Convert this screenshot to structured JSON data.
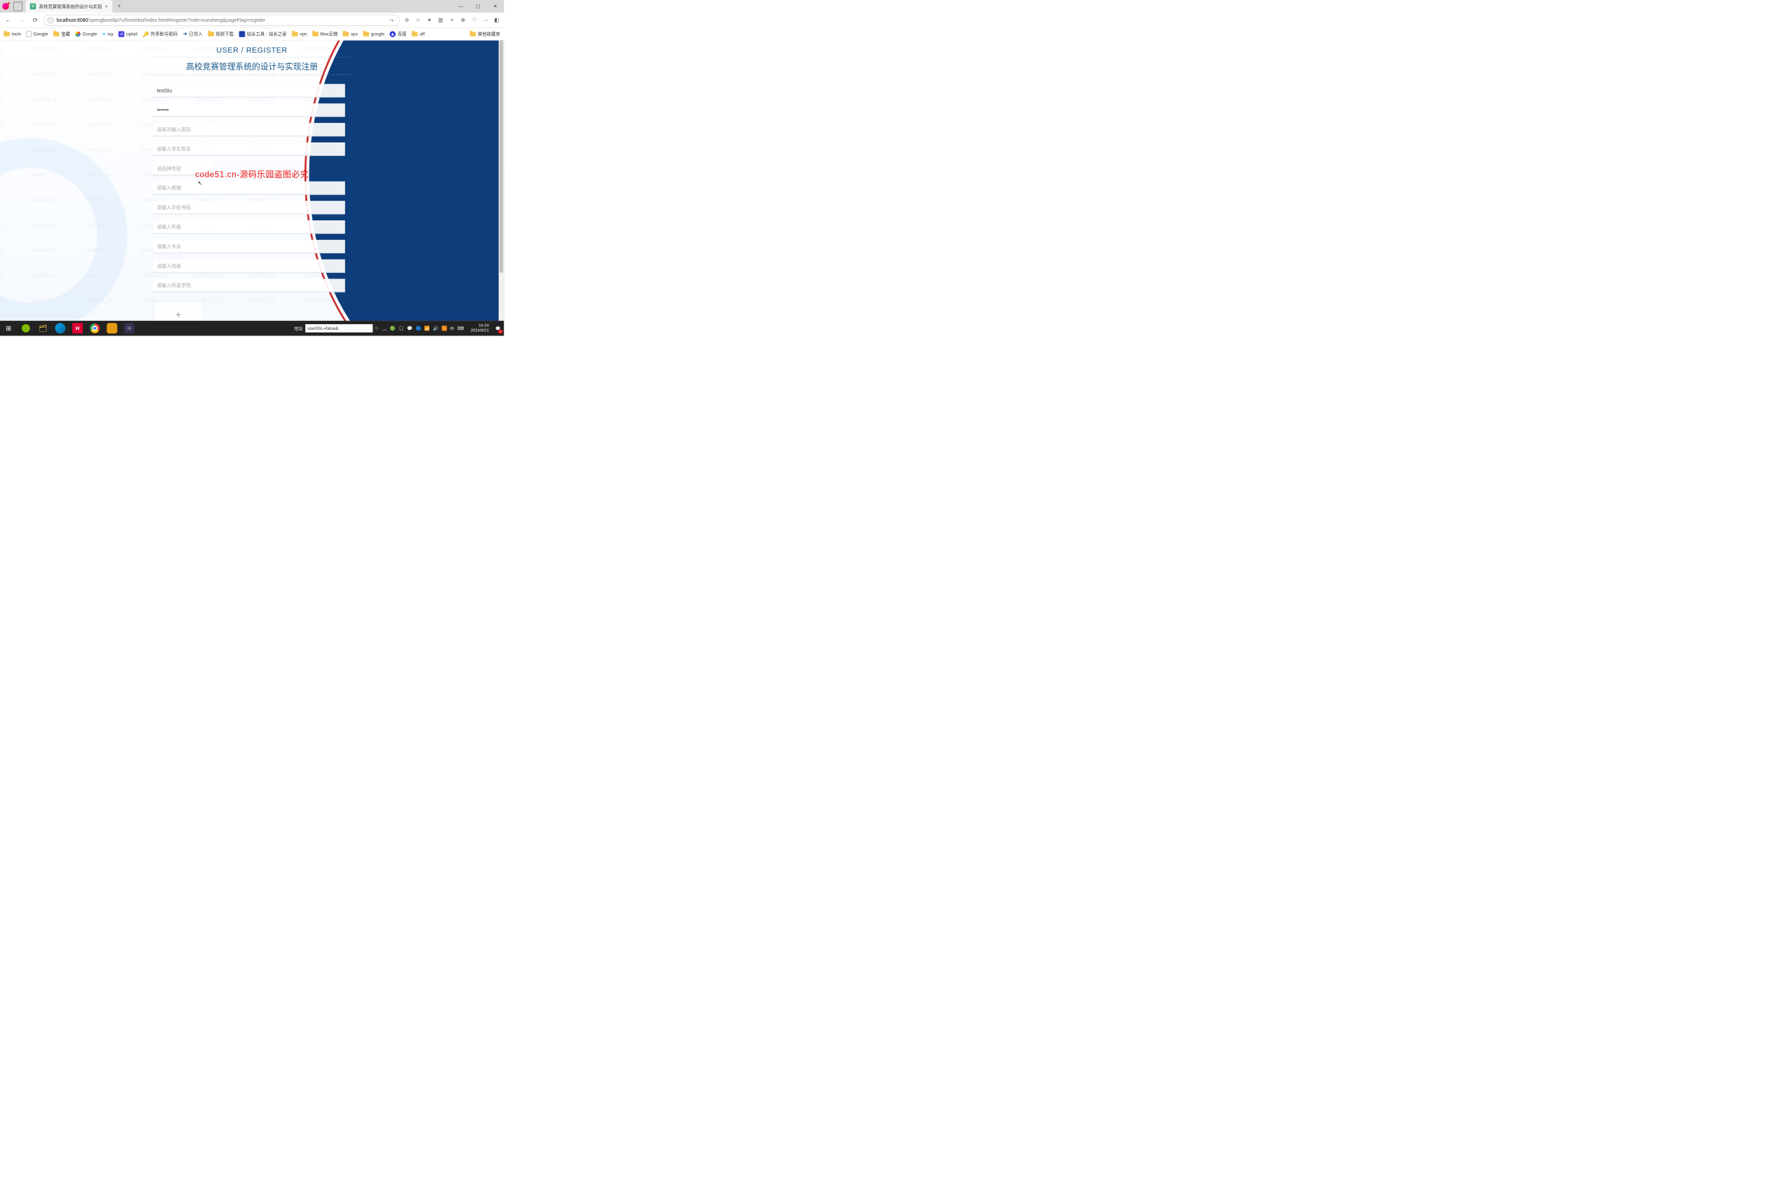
{
  "browser": {
    "tab_title": "高校竞赛管理系统的设计与实现",
    "url_host": "localhost",
    "url_port": ":8080",
    "url_path": "/springboot9pi7u/front/dist/index.html#/register?role=xuesheng&pageFlag=register"
  },
  "bookmarks": [
    {
      "type": "folder",
      "label": "tools"
    },
    {
      "type": "page",
      "label": "Google"
    },
    {
      "type": "folder",
      "label": "宝藏"
    },
    {
      "type": "g",
      "label": "Google"
    },
    {
      "type": "txy",
      "label": "txy"
    },
    {
      "type": "sl",
      "label": "uplod"
    },
    {
      "type": "key",
      "label": "共享账号密码"
    },
    {
      "type": "arrow",
      "label": "已导入"
    },
    {
      "type": "folder",
      "label": "视频下载"
    },
    {
      "type": "tool",
      "label": "站长工具 - 站长之家"
    },
    {
      "type": "folder",
      "label": "vpn"
    },
    {
      "type": "folder",
      "label": "Max云梯"
    },
    {
      "type": "folder",
      "label": "vps"
    },
    {
      "type": "folder",
      "label": "google"
    },
    {
      "type": "baidu",
      "label": "百度"
    },
    {
      "type": "folder",
      "label": "aff"
    }
  ],
  "bookmarks_overflow": "其他收藏夹",
  "page": {
    "heading": "USER / REGISTER",
    "subheading": "高校竞赛管理系统的设计与实现注册",
    "watermark_text": "code51.cn",
    "watermark_red": "code51.cn-源码乐园盗图必究",
    "fields": {
      "username_value": "testStu",
      "password_value": "•••••••",
      "password2_ph": "请再次输入密码",
      "name_ph": "请输入学生姓名",
      "gender_ph": "请选择性别",
      "email_ph": "请输入邮箱",
      "phone_ph": "请输入手机号码",
      "grade_ph": "请输入年级",
      "major_ph": "请输入专业",
      "class_ph": "请输入班级",
      "college_ph": "请输入所属学院"
    }
  },
  "taskbar": {
    "addr_label": "地址",
    "addr_value": "useSSL=false&",
    "ime": "中",
    "time": "16:24",
    "date": "2024/9/21",
    "notif_count": "7"
  }
}
